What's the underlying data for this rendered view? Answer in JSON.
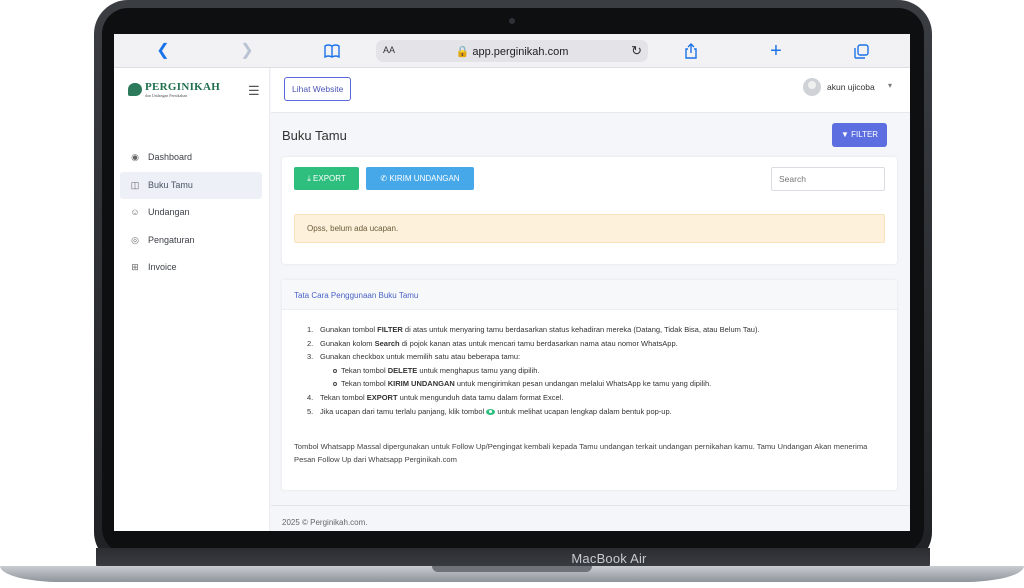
{
  "device": {
    "model_label": "MacBook Air"
  },
  "browser": {
    "text_size_label": "AA",
    "url": "app.perginikah.com"
  },
  "sidebar": {
    "logo_text": "PERGINIKAH",
    "logo_tagline": "dan Undangan Pernikahan",
    "items": [
      {
        "label": "Dashboard",
        "icon": "gauge-icon"
      },
      {
        "label": "Buku Tamu",
        "icon": "book-icon",
        "active": true
      },
      {
        "label": "Undangan",
        "icon": "card-icon"
      },
      {
        "label": "Pengaturan",
        "icon": "gear-icon"
      },
      {
        "label": "Invoice",
        "icon": "cart-icon"
      }
    ]
  },
  "topbar": {
    "view_site_label": "Lihat Website",
    "username": "akun ujicoba"
  },
  "page": {
    "title": "Buku Tamu",
    "filter_label": "FILTER",
    "export_label": "EXPORT",
    "send_invite_label": "KIRIM UNDANGAN",
    "search_placeholder": "Search",
    "empty_alert": "Opss, belum ada ucapan."
  },
  "guide": {
    "title": "Tata Cara Penggunaan Buku Tamu",
    "s1_pre": "Gunakan tombol ",
    "s1_bold": "FILTER",
    "s1_post": " di atas untuk menyaring tamu berdasarkan status kehadiran mereka (Datang, Tidak Bisa, atau Belum Tau).",
    "s2_pre": "Gunakan kolom ",
    "s2_bold": "Search",
    "s2_post": " di pojok kanan atas untuk mencari tamu berdasarkan nama atau nomor WhatsApp.",
    "s3": "Gunakan checkbox untuk memilih satu atau beberapa tamu:",
    "s3a_pre": "Tekan tombol ",
    "s3a_bold": "DELETE",
    "s3a_post": " untuk menghapus tamu yang dipilih.",
    "s3b_pre": "Tekan tombol ",
    "s3b_bold": "KIRIM UNDANGAN",
    "s3b_post": " untuk mengirimkan pesan undangan melalui WhatsApp ke tamu yang dipilih.",
    "s4_pre": "Tekan tombol ",
    "s4_bold": "EXPORT",
    "s4_post": " untuk mengunduh data tamu dalam format Excel.",
    "s5_pre": "Jika ucapan dari tamu terlalu panjang, klik tombol ",
    "s5_post": " untuk melihat ucapan lengkap dalam bentuk pop-up.",
    "note": "Tombol Whatsapp Massal dipergunakan untuk Follow Up/Pengingat kembali kepada Tamu undangan terkait undangan pernikahan kamu. Tamu Undangan Akan menerima Pesan Follow Up dari Whatsapp Perginikah.com"
  },
  "footer": {
    "text": "2025 © Perginikah.com."
  }
}
